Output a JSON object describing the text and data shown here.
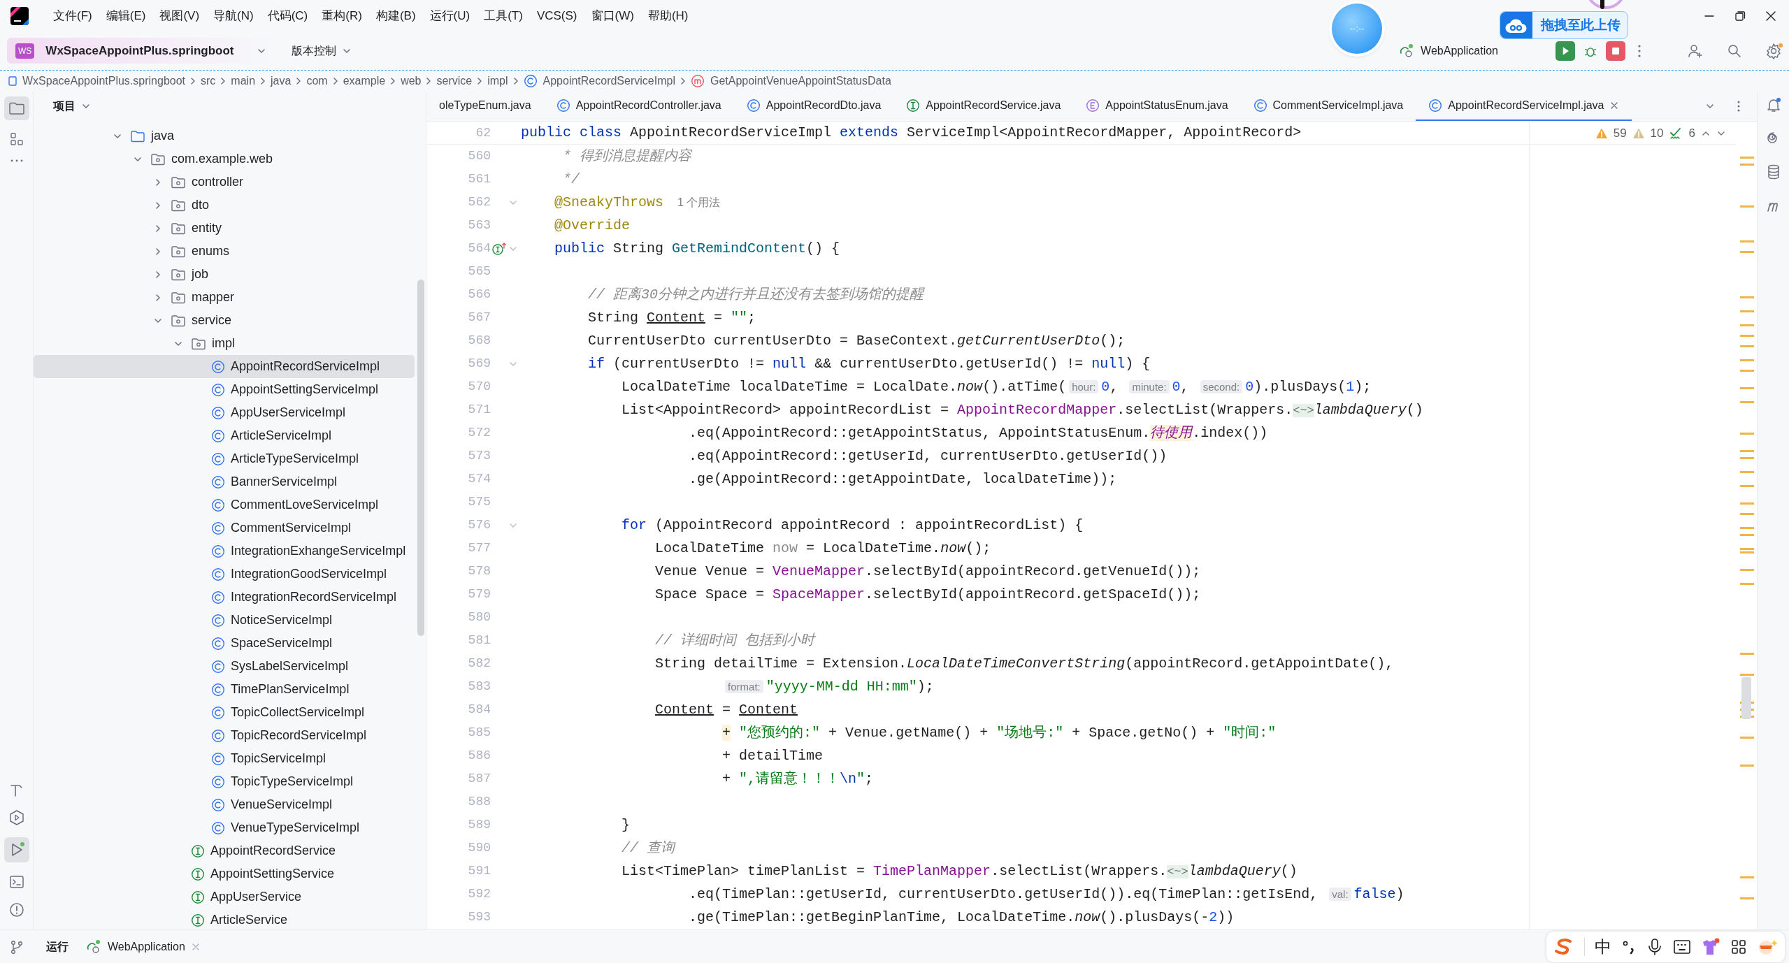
{
  "menu": [
    "文件(F)",
    "编辑(E)",
    "视图(V)",
    "导航(N)",
    "代码(C)",
    "重构(R)",
    "构建(B)",
    "运行(U)",
    "工具(T)",
    "VCS(S)",
    "窗口(W)",
    "帮助(H)"
  ],
  "toolbar": {
    "project_badge": "WS",
    "project": "WxSpaceAppointPlus.springboot",
    "vcs": "版本控制",
    "run_config": "WebApplication"
  },
  "clock_widget": {
    "text": "--:--"
  },
  "upload_widget": {
    "text": "拖拽至此上传"
  },
  "breadcrumb": [
    {
      "label": "WxSpaceAppointPlus.springboot",
      "kind": "module"
    },
    {
      "label": "src",
      "kind": "dir"
    },
    {
      "label": "main",
      "kind": "dir"
    },
    {
      "label": "java",
      "kind": "dir"
    },
    {
      "label": "com",
      "kind": "dir"
    },
    {
      "label": "example",
      "kind": "dir"
    },
    {
      "label": "web",
      "kind": "dir"
    },
    {
      "label": "service",
      "kind": "dir"
    },
    {
      "label": "impl",
      "kind": "dir"
    },
    {
      "label": "AppointRecordServiceImpl",
      "kind": "class"
    },
    {
      "label": "GetAppointVenueAppointStatusData",
      "kind": "method"
    }
  ],
  "project_panel": {
    "title": "项目",
    "tree": [
      {
        "label": "java",
        "kind": "source-root",
        "expanded": true,
        "selected": false,
        "children": [
          {
            "label": "com.example.web",
            "kind": "package",
            "expanded": true,
            "selected": false,
            "children": [
              {
                "label": "controller",
                "kind": "package",
                "expanded": false,
                "selected": false
              },
              {
                "label": "dto",
                "kind": "package",
                "expanded": false,
                "selected": false
              },
              {
                "label": "entity",
                "kind": "package",
                "expanded": false,
                "selected": false
              },
              {
                "label": "enums",
                "kind": "package",
                "expanded": false,
                "selected": false
              },
              {
                "label": "job",
                "kind": "package",
                "expanded": false,
                "selected": false
              },
              {
                "label": "mapper",
                "kind": "package",
                "expanded": false,
                "selected": false
              },
              {
                "label": "service",
                "kind": "package",
                "expanded": true,
                "selected": false,
                "children": [
                  {
                    "label": "impl",
                    "kind": "package",
                    "expanded": true,
                    "selected": false,
                    "children": [
                      {
                        "label": "AppointRecordServiceImpl",
                        "kind": "class",
                        "selected": true
                      },
                      {
                        "label": "AppointSettingServiceImpl",
                        "kind": "class",
                        "selected": false
                      },
                      {
                        "label": "AppUserServiceImpl",
                        "kind": "class",
                        "selected": false
                      },
                      {
                        "label": "ArticleServiceImpl",
                        "kind": "class",
                        "selected": false
                      },
                      {
                        "label": "ArticleTypeServiceImpl",
                        "kind": "class",
                        "selected": false
                      },
                      {
                        "label": "BannerServiceImpl",
                        "kind": "class",
                        "selected": false
                      },
                      {
                        "label": "CommentLoveServiceImpl",
                        "kind": "class",
                        "selected": false
                      },
                      {
                        "label": "CommentServiceImpl",
                        "kind": "class",
                        "selected": false
                      },
                      {
                        "label": "IntegrationExhangeServiceImpl",
                        "kind": "class",
                        "selected": false
                      },
                      {
                        "label": "IntegrationGoodServiceImpl",
                        "kind": "class",
                        "selected": false
                      },
                      {
                        "label": "IntegrationRecordServiceImpl",
                        "kind": "class",
                        "selected": false
                      },
                      {
                        "label": "NoticeServiceImpl",
                        "kind": "class",
                        "selected": false
                      },
                      {
                        "label": "SpaceServiceImpl",
                        "kind": "class",
                        "selected": false
                      },
                      {
                        "label": "SysLabelServiceImpl",
                        "kind": "class",
                        "selected": false
                      },
                      {
                        "label": "TimePlanServiceImpl",
                        "kind": "class",
                        "selected": false
                      },
                      {
                        "label": "TopicCollectServiceImpl",
                        "kind": "class",
                        "selected": false
                      },
                      {
                        "label": "TopicRecordServiceImpl",
                        "kind": "class",
                        "selected": false
                      },
                      {
                        "label": "TopicServiceImpl",
                        "kind": "class",
                        "selected": false
                      },
                      {
                        "label": "TopicTypeServiceImpl",
                        "kind": "class",
                        "selected": false
                      },
                      {
                        "label": "VenueServiceImpl",
                        "kind": "class",
                        "selected": false
                      },
                      {
                        "label": "VenueTypeServiceImpl",
                        "kind": "class",
                        "selected": false
                      }
                    ]
                  },
                  {
                    "label": "AppointRecordService",
                    "kind": "interface",
                    "selected": false
                  },
                  {
                    "label": "AppointSettingService",
                    "kind": "interface",
                    "selected": false
                  },
                  {
                    "label": "AppUserService",
                    "kind": "interface",
                    "selected": false
                  },
                  {
                    "label": "ArticleService",
                    "kind": "interface",
                    "selected": false
                  }
                ]
              }
            ]
          }
        ]
      }
    ]
  },
  "editor_tabs": [
    {
      "label": "oleTypeEnum.java",
      "kind": "cut",
      "selected": false
    },
    {
      "label": "AppointRecordController.java",
      "kind": "class",
      "selected": false
    },
    {
      "label": "AppointRecordDto.java",
      "kind": "class",
      "selected": false
    },
    {
      "label": "AppointRecordService.java",
      "kind": "interface",
      "selected": false
    },
    {
      "label": "AppointStatusEnum.java",
      "kind": "enum",
      "selected": false
    },
    {
      "label": "CommentServiceImpl.java",
      "kind": "class",
      "selected": false
    },
    {
      "label": "AppointRecordServiceImpl.java",
      "kind": "class",
      "selected": true
    }
  ],
  "sticky_line": {
    "number": "62",
    "tokens": [
      {
        "kind": "k",
        "text": "public class "
      },
      {
        "kind": "p",
        "text": "AppointRecordServiceImpl "
      },
      {
        "kind": "k",
        "text": "extends "
      },
      {
        "kind": "p",
        "text": "ServiceImpl<AppointRecordMapper, AppointRecord>"
      }
    ]
  },
  "inspections": {
    "warnings": "59",
    "weak_warnings": "10",
    "typos": "6"
  },
  "code_lines": [
    {
      "number": "560",
      "tokens": [
        {
          "kind": "c",
          "text": "     * 得到消息提醒内容"
        }
      ]
    },
    {
      "number": "561",
      "tokens": [
        {
          "kind": "c",
          "text": "     */"
        }
      ]
    },
    {
      "number": "562",
      "foldable": true,
      "tokens": [
        {
          "kind": "a",
          "text": "    @SneakyThrows"
        },
        {
          "kind": "u",
          "text": "1 个用法"
        }
      ]
    },
    {
      "number": "563",
      "tokens": [
        {
          "kind": "a",
          "text": "    @Override"
        }
      ]
    },
    {
      "number": "564",
      "foldable": true,
      "implements_marker": true,
      "tokens": [
        {
          "kind": "k",
          "text": "    public "
        },
        {
          "kind": "p",
          "text": "String "
        },
        {
          "kind": "f",
          "text": "GetRemindContent"
        },
        {
          "kind": "p",
          "text": "() {"
        }
      ]
    },
    {
      "number": "565"
    },
    {
      "number": "566",
      "tokens": [
        {
          "kind": "c",
          "text": "        // 距离30分钟之内进行并且还没有去签到场馆的提醒"
        }
      ]
    },
    {
      "number": "567",
      "tokens": [
        {
          "kind": "p",
          "text": "        String "
        },
        {
          "kind": "ul",
          "text": "Content"
        },
        {
          "kind": "p",
          "text": " = "
        },
        {
          "kind": "s",
          "text": "\"\""
        },
        {
          "kind": "p",
          "text": ";"
        }
      ]
    },
    {
      "number": "568",
      "tokens": [
        {
          "kind": "p",
          "text": "        CurrentUserDto currentUserDto = BaseContext."
        },
        {
          "kind": "i",
          "text": "getCurrentUserDto"
        },
        {
          "kind": "p",
          "text": "();"
        }
      ]
    },
    {
      "number": "569",
      "foldable": true,
      "tokens": [
        {
          "kind": "k",
          "text": "        if"
        },
        {
          "kind": "p",
          "text": " (currentUserDto != "
        },
        {
          "kind": "k",
          "text": "null"
        },
        {
          "kind": "p",
          "text": " && currentUserDto.getUserId() != "
        },
        {
          "kind": "k",
          "text": "null"
        },
        {
          "kind": "p",
          "text": ") {"
        }
      ]
    },
    {
      "number": "570",
      "tokens": [
        {
          "kind": "p",
          "text": "            LocalDateTime localDateTime = LocalDate."
        },
        {
          "kind": "i",
          "text": "now"
        },
        {
          "kind": "p",
          "text": "().atTime("
        },
        {
          "kind": "h",
          "text": "hour:"
        },
        {
          "kind": "n",
          "text": "0"
        },
        {
          "kind": "p",
          "text": ", "
        },
        {
          "kind": "h",
          "text": "minute:"
        },
        {
          "kind": "n",
          "text": "0"
        },
        {
          "kind": "p",
          "text": ", "
        },
        {
          "kind": "h",
          "text": "second:"
        },
        {
          "kind": "n",
          "text": "0"
        },
        {
          "kind": "p",
          "text": ").plusDays("
        },
        {
          "kind": "n",
          "text": "1"
        },
        {
          "kind": "p",
          "text": ");"
        }
      ]
    },
    {
      "number": "571",
      "tokens": [
        {
          "kind": "p",
          "text": "            List<AppointRecord> appointRecordList = "
        },
        {
          "kind": "m",
          "text": "AppointRecordMapper"
        },
        {
          "kind": "p",
          "text": ".selectList(Wrappers."
        },
        {
          "kind": "d",
          "text": "<~>"
        },
        {
          "kind": "i",
          "text": "lambdaQuery"
        },
        {
          "kind": "p",
          "text": "()"
        }
      ]
    },
    {
      "number": "572",
      "tokens": [
        {
          "kind": "p",
          "text": "                    .eq(AppointRecord::getAppointStatus, AppointStatusEnum."
        },
        {
          "kind": "y",
          "text": "待使用"
        },
        {
          "kind": "p",
          "text": ".index())"
        }
      ]
    },
    {
      "number": "573",
      "tokens": [
        {
          "kind": "p",
          "text": "                    .eq(AppointRecord::getUserId, currentUserDto.getUserId())"
        }
      ]
    },
    {
      "number": "574",
      "tokens": [
        {
          "kind": "p",
          "text": "                    .ge(AppointRecord::getAppointDate, localDateTime));"
        }
      ]
    },
    {
      "number": "575"
    },
    {
      "number": "576",
      "foldable": true,
      "tokens": [
        {
          "kind": "k",
          "text": "            for"
        },
        {
          "kind": "p",
          "text": " (AppointRecord appointRecord : appointRecordList) {"
        }
      ]
    },
    {
      "number": "577",
      "tokens": [
        {
          "kind": "p",
          "text": "                LocalDateTime "
        },
        {
          "kind": "g",
          "text": "now"
        },
        {
          "kind": "p",
          "text": " = LocalDateTime."
        },
        {
          "kind": "i",
          "text": "now"
        },
        {
          "kind": "p",
          "text": "();"
        }
      ]
    },
    {
      "number": "578",
      "tokens": [
        {
          "kind": "p",
          "text": "                Venue Venue = "
        },
        {
          "kind": "m",
          "text": "VenueMapper"
        },
        {
          "kind": "p",
          "text": ".selectById(appointRecord.getVenueId());"
        }
      ]
    },
    {
      "number": "579",
      "tokens": [
        {
          "kind": "p",
          "text": "                Space Space = "
        },
        {
          "kind": "m",
          "text": "SpaceMapper"
        },
        {
          "kind": "p",
          "text": ".selectById(appointRecord.getSpaceId());"
        }
      ]
    },
    {
      "number": "580"
    },
    {
      "number": "581",
      "tokens": [
        {
          "kind": "c",
          "text": "                // 详细时间 包括到小时"
        }
      ]
    },
    {
      "number": "582",
      "tokens": [
        {
          "kind": "p",
          "text": "                String detailTime = Extension."
        },
        {
          "kind": "i",
          "text": "LocalDateTimeConvertString"
        },
        {
          "kind": "p",
          "text": "(appointRecord.getAppointDate(),"
        }
      ]
    },
    {
      "number": "583",
      "tokens": [
        {
          "kind": "h",
          "text": "                        format:"
        },
        {
          "kind": "s",
          "text": "\"yyyy-MM-dd HH:mm\""
        },
        {
          "kind": "p",
          "text": ");"
        }
      ]
    },
    {
      "number": "584",
      "tokens": [
        {
          "kind": "ul",
          "text": "                Content"
        },
        {
          "kind": "p",
          "text": " = "
        },
        {
          "kind": "ul",
          "text": "Content"
        }
      ]
    },
    {
      "number": "585",
      "tokens": [
        {
          "kind": "hl",
          "text": "                        +"
        },
        {
          "kind": "s",
          "text": " \"您预约的:\""
        },
        {
          "kind": "p",
          "text": " + Venue.getName() + "
        },
        {
          "kind": "s",
          "text": "\"场地号:\""
        },
        {
          "kind": "p",
          "text": " + Space.getNo() + "
        },
        {
          "kind": "s",
          "text": "\"时间:\""
        }
      ]
    },
    {
      "number": "586",
      "tokens": [
        {
          "kind": "p",
          "text": "                        + detailTime"
        }
      ]
    },
    {
      "number": "587",
      "tokens": [
        {
          "kind": "p",
          "text": "                        + "
        },
        {
          "kind": "s",
          "text": "\",请留意！！！"
        },
        {
          "kind": "e",
          "text": "\\n"
        },
        {
          "kind": "s",
          "text": "\""
        },
        {
          "kind": "p",
          "text": ";"
        }
      ]
    },
    {
      "number": "588"
    },
    {
      "number": "589",
      "tokens": [
        {
          "kind": "p",
          "text": "            }"
        }
      ]
    },
    {
      "number": "590",
      "tokens": [
        {
          "kind": "c",
          "text": "            // 查询"
        }
      ]
    },
    {
      "number": "591",
      "tokens": [
        {
          "kind": "p",
          "text": "            List<TimePlan> timePlanList = "
        },
        {
          "kind": "m",
          "text": "TimePlanMapper"
        },
        {
          "kind": "p",
          "text": ".selectList(Wrappers."
        },
        {
          "kind": "d",
          "text": "<~>"
        },
        {
          "kind": "i",
          "text": "lambdaQuery"
        },
        {
          "kind": "p",
          "text": "()"
        }
      ]
    },
    {
      "number": "592",
      "tokens": [
        {
          "kind": "p",
          "text": "                    .eq(TimePlan::getUserId, currentUserDto.getUserId()).eq(TimePlan::getIsEnd, "
        },
        {
          "kind": "h",
          "text": "val:"
        },
        {
          "kind": "k",
          "text": "false"
        },
        {
          "kind": "p",
          "text": ")"
        }
      ]
    },
    {
      "number": "593",
      "tokens": [
        {
          "kind": "p",
          "text": "                    .ge(TimePlan::getBeginPlanTime, LocalDateTime."
        },
        {
          "kind": "i",
          "text": "now"
        },
        {
          "kind": "p",
          "text": "().plusDays(-"
        },
        {
          "kind": "n",
          "text": "2"
        },
        {
          "kind": "p",
          "text": "))"
        }
      ]
    }
  ],
  "bottom_panel": {
    "title": "运行",
    "tabs": [
      {
        "label": "WebApplication"
      }
    ]
  },
  "ime": {
    "mode": "中"
  }
}
